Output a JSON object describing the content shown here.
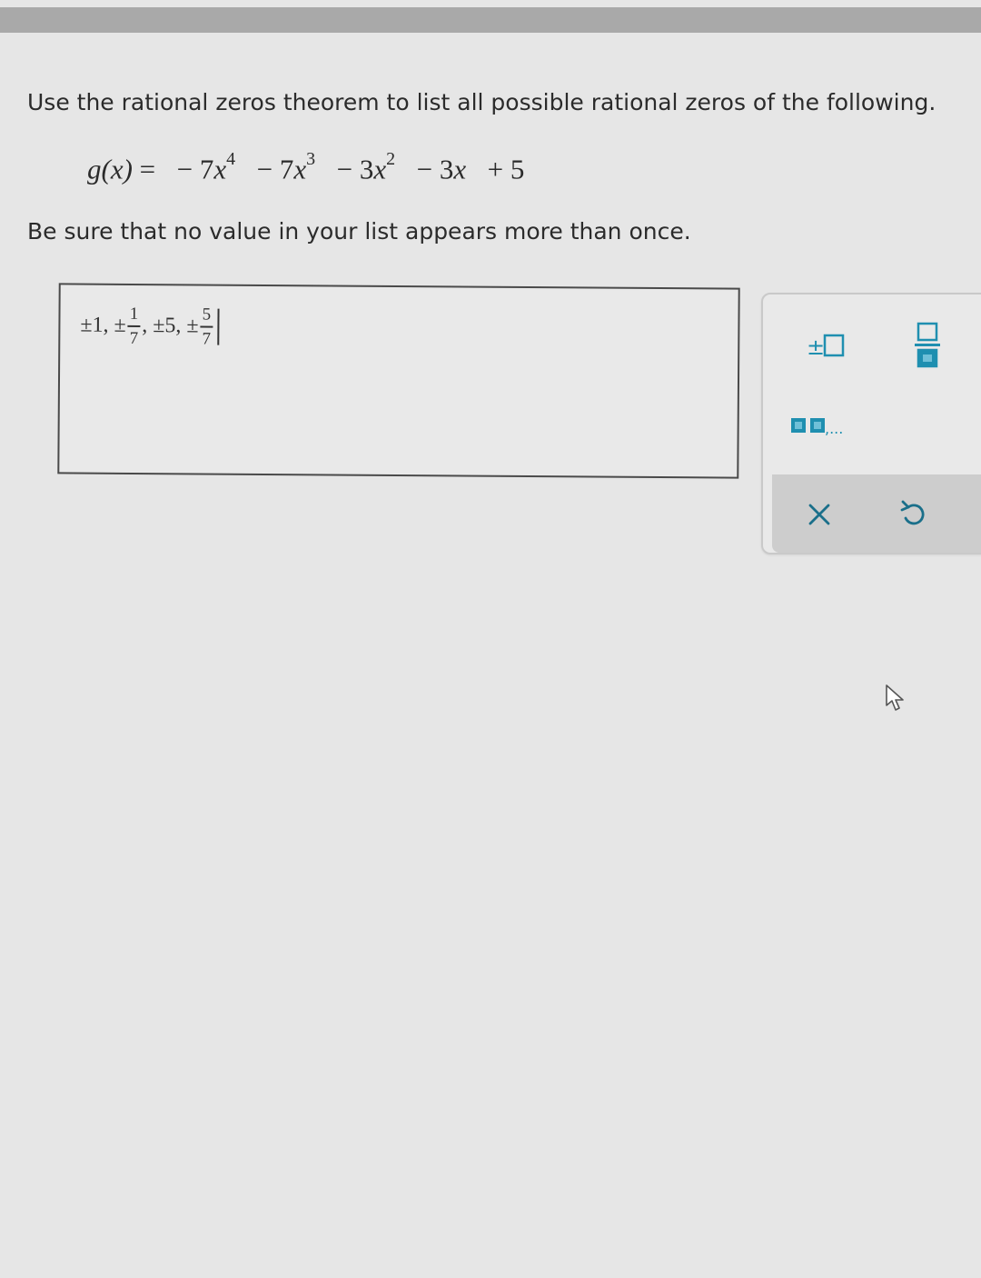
{
  "question": {
    "instruction": "Use the rational zeros theorem to list all possible rational zeros of the following.",
    "function": {
      "lhs": "g(x)",
      "equals": "=",
      "terms": [
        {
          "sign": "−",
          "coef": "7",
          "var": "x",
          "exp": "4"
        },
        {
          "sign": "−",
          "coef": "7",
          "var": "x",
          "exp": "3"
        },
        {
          "sign": "−",
          "coef": "3",
          "var": "x",
          "exp": "2"
        },
        {
          "sign": "−",
          "coef": "3",
          "var": "x",
          "exp": ""
        },
        {
          "sign": "+",
          "coef": "5",
          "var": "",
          "exp": ""
        }
      ]
    },
    "note": "Be sure that no value in your list appears more than once."
  },
  "answer": {
    "terms": [
      {
        "prefix": "±1,",
        "num": "",
        "den": ""
      },
      {
        "prefix": "±",
        "num": "1",
        "den": "7",
        "suffix": ","
      },
      {
        "prefix": "±5,",
        "num": "",
        "den": ""
      },
      {
        "prefix": "±",
        "num": "5",
        "den": "7",
        "suffix": ""
      }
    ]
  },
  "palette": {
    "buttons": [
      {
        "icon": "plus-minus-box-icon",
        "label": "±"
      },
      {
        "icon": "fraction-template-icon"
      },
      {
        "icon": "list-template-icon",
        "label": ",..."
      },
      {
        "icon": "close-icon"
      },
      {
        "icon": "undo-icon"
      }
    ],
    "accent": "#1f8fb0"
  }
}
